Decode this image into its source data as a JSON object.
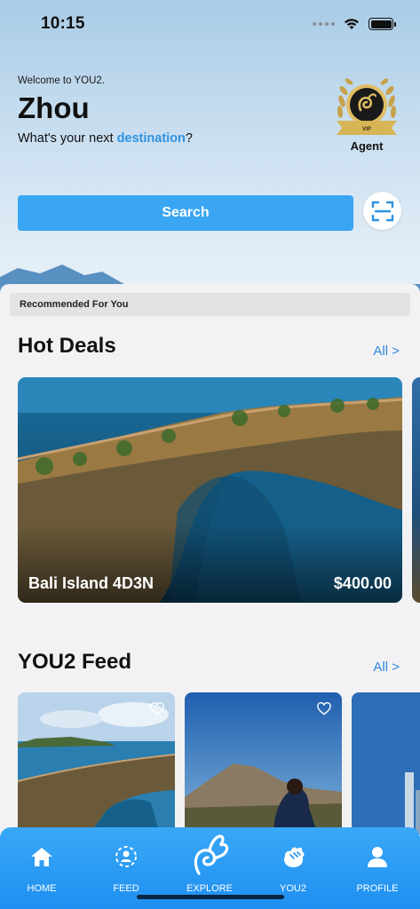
{
  "status_bar": {
    "time": "10:15"
  },
  "header": {
    "welcome": "Welcome to YOU2.",
    "user_name": "Zhou",
    "tagline_prefix": "What's your next ",
    "tagline_accent": "destination",
    "tagline_suffix": "?",
    "badge_tier": "VIP",
    "badge_label": "Agent",
    "search_label": "Search"
  },
  "sections": {
    "recommended_label": "Recommended For You",
    "hot_deals_title": "Hot Deals",
    "hot_deals_all": "All >",
    "feed_title": "YOU2 Feed",
    "feed_all": "All >"
  },
  "deals": [
    {
      "name": "Bali Island 4D3N",
      "price": "$400.00"
    }
  ],
  "tabs": [
    {
      "label": "HOME",
      "icon": "home-icon"
    },
    {
      "label": "FEED",
      "icon": "feed-icon"
    },
    {
      "label": "EXPLORE",
      "icon": "explore-logo-icon"
    },
    {
      "label": "YOU2",
      "icon": "hand-icon"
    },
    {
      "label": "PROFILE",
      "icon": "profile-icon"
    }
  ],
  "colors": {
    "accent": "#3aa5f3",
    "link": "#2e86de",
    "tabbar": "#1e8ff0"
  }
}
